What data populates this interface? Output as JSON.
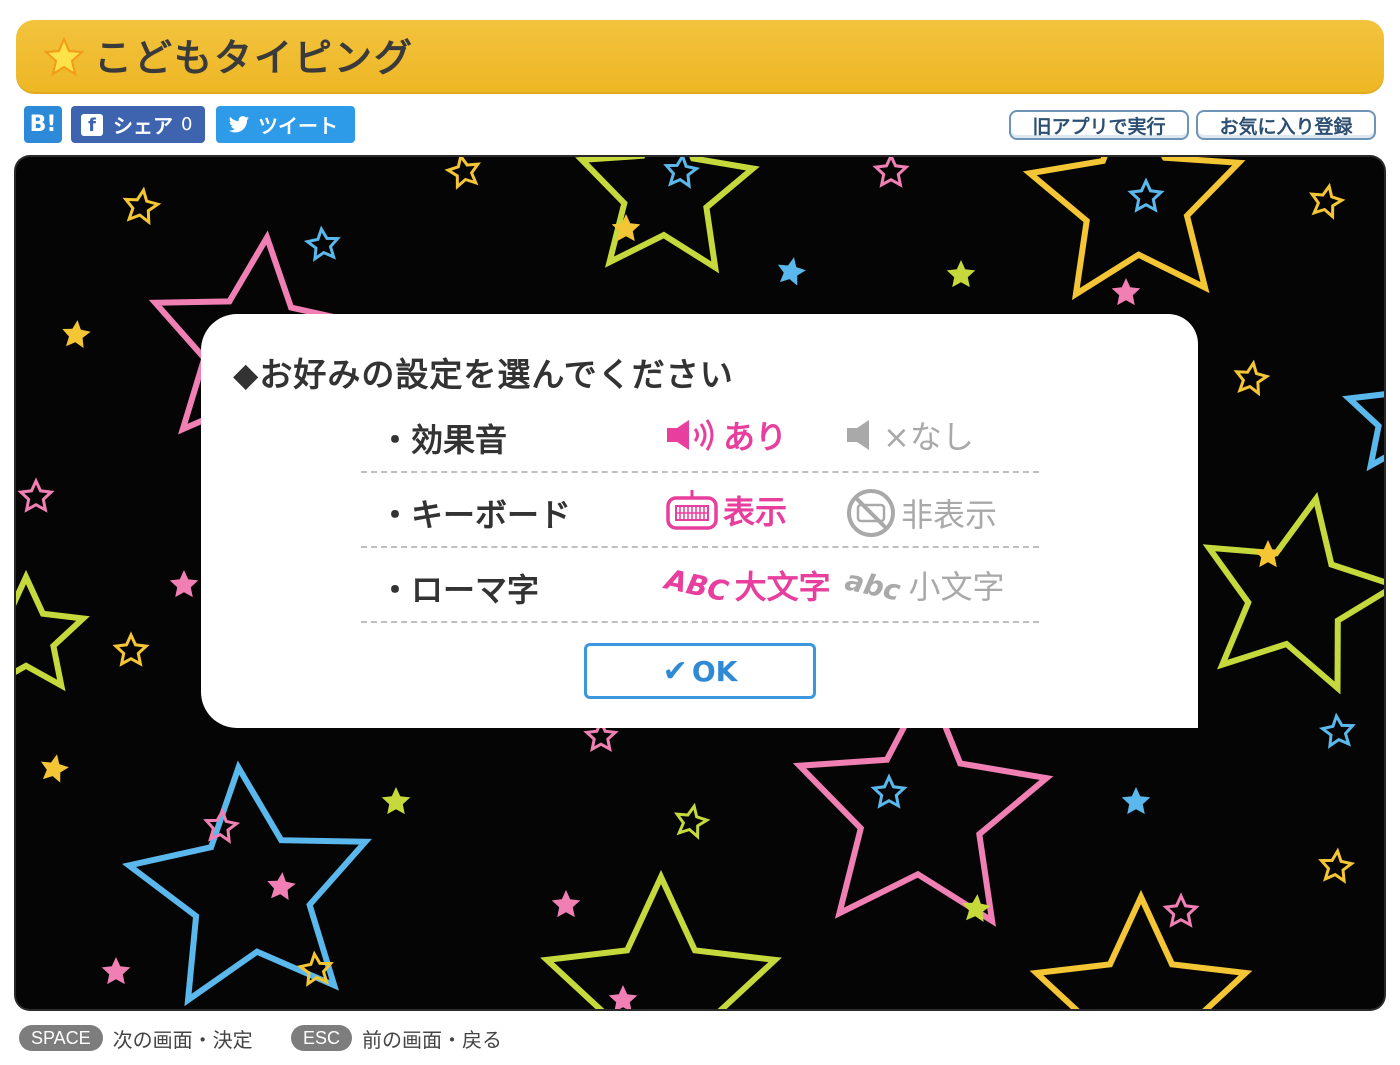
{
  "header": {
    "title": "こどもタイピング"
  },
  "share": {
    "hatena_label": "B!",
    "facebook_label": "シェア",
    "facebook_count": "0",
    "twitter_label": "ツイート"
  },
  "actions": {
    "old_app_label": "旧アプリで実行",
    "favorite_label": "お気に入り登録"
  },
  "dialog": {
    "title": "◆お好みの設定を選んでください",
    "rows": [
      {
        "label": "・効果音",
        "on_option": "あり",
        "off_option": "×なし",
        "on_icon": "speaker-on-icon",
        "off_icon": "speaker-muted-icon"
      },
      {
        "label": "・キーボード",
        "on_option": "表示",
        "off_option": "非表示",
        "on_icon": "keyboard-icon",
        "off_icon": "keyboard-hidden-icon"
      },
      {
        "label": "・ローマ字",
        "on_option": "大文字",
        "off_option": "小文字",
        "on_icon": "abc-uppercase-icon",
        "off_icon": "abc-lowercase-icon",
        "on_icon_text": "ABC",
        "off_icon_text": "abc"
      }
    ],
    "ok_label": "OK"
  },
  "footer": {
    "hints": [
      {
        "key": "SPACE",
        "text": "次の画面・決定"
      },
      {
        "key": "ESC",
        "text": "前の画面・戻る"
      }
    ]
  },
  "colors": {
    "title_bar": "#f0bd33",
    "accent_pink": "#e83e9d",
    "accent_blue": "#3b97de",
    "star_yellow": "#f4c534",
    "star_pink": "#f07fb4",
    "star_blue": "#5bb8ec",
    "star_green": "#c5d93c"
  }
}
